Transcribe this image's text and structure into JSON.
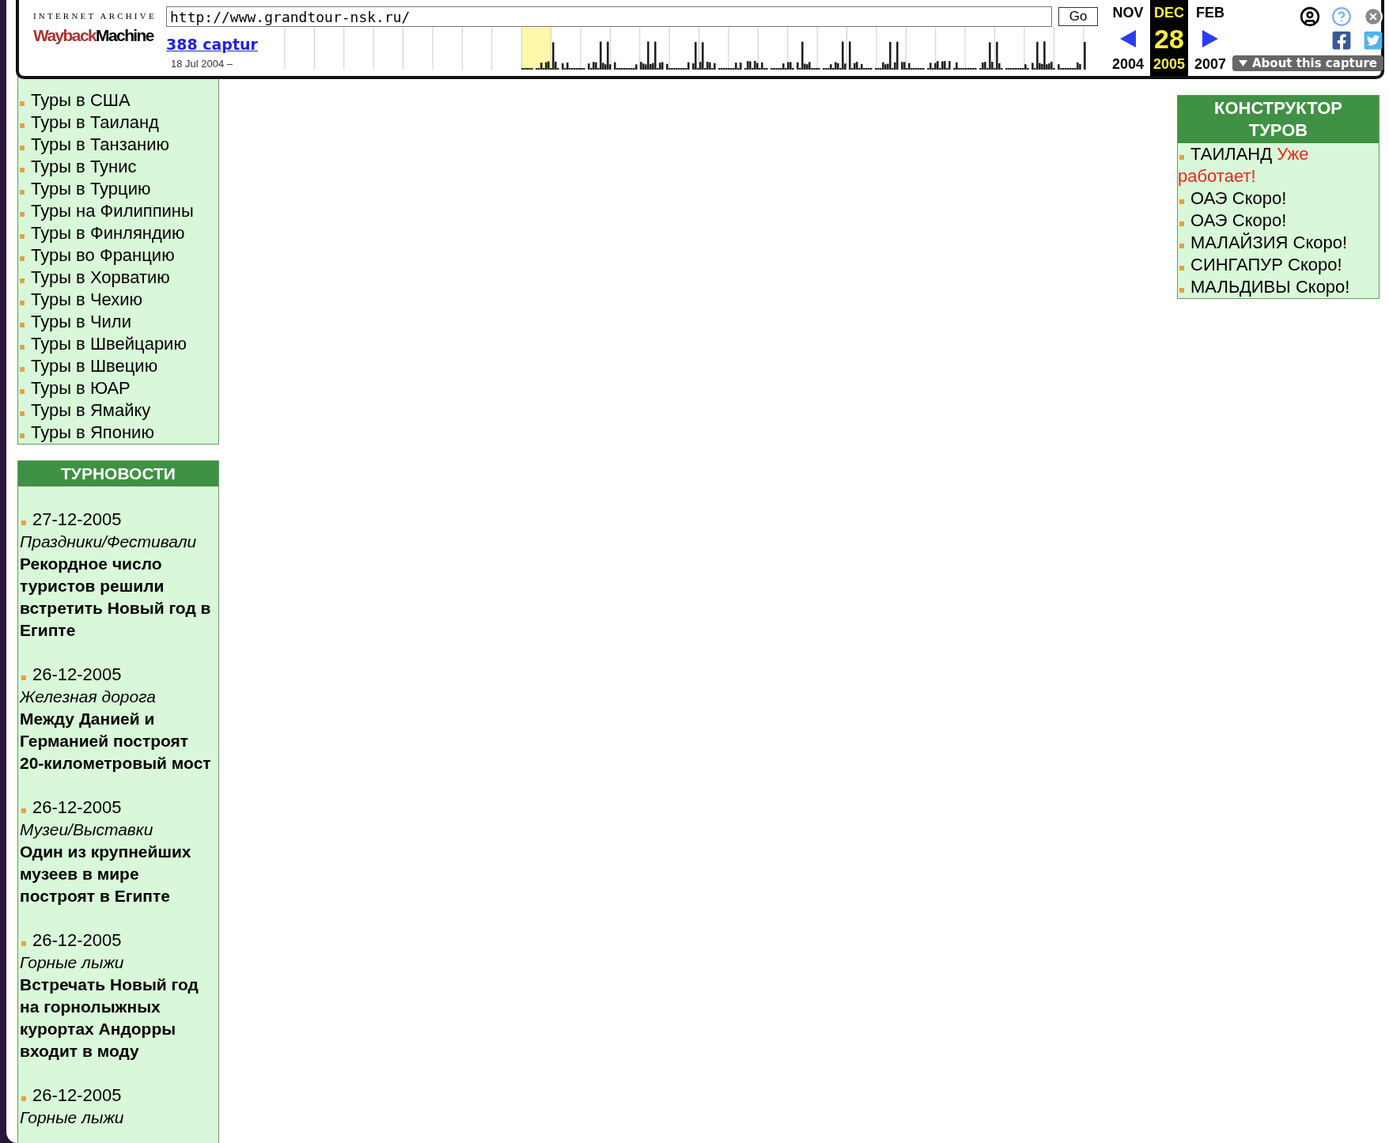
{
  "toolbar": {
    "logo": {
      "caption": "INTERNET ARCHIVE",
      "word_1": "Wayback",
      "word_2": "Machine"
    },
    "url": "http://www.grandtour-nsk.ru/",
    "go_button": "Go",
    "captures_link": "388 captur",
    "date_range": "18 Jul 2004 –",
    "calendar": [
      {
        "month": "NOV",
        "year": "2004",
        "selected": false
      },
      {
        "month": "DEC",
        "day": "28",
        "year": "2005",
        "selected": true
      },
      {
        "month": "FEB",
        "year": "2007",
        "selected": false
      }
    ],
    "about_button": "About this capture"
  },
  "country_list": [
    "Туры в США",
    "Туры в Таиланд",
    "Туры в Танзанию",
    "Туры в Тунис",
    "Туры в Турцию",
    "Туры на Филиппины",
    "Туры в Финляндию",
    "Туры во Францию",
    "Туры в Хорватию",
    "Туры в Чехию",
    "Туры в Чили",
    "Туры в Швейцарию",
    "Туры в Швецию",
    "Туры в ЮАР",
    "Туры в Ямайку",
    "Туры в Японию"
  ],
  "news": {
    "title": "ТУРНОВОСТИ",
    "items": [
      {
        "date": "27-12-2005",
        "category": "Праздники/Фестивали",
        "headline": "Рекордное число туристов решили встретить Новый год в Египте"
      },
      {
        "date": "26-12-2005",
        "category": "Железная дорога",
        "headline": "Между Данией и Германией построят 20-километровый мост"
      },
      {
        "date": "26-12-2005",
        "category": "Музеи/Выставки",
        "headline": "Один из крупнейших музеев в мире построят в Египте"
      },
      {
        "date": "26-12-2005",
        "category": "Горные лыжи",
        "headline": "Встречать Новый год на горнолыжных курортах Андорры входит в моду"
      },
      {
        "date": "26-12-2005",
        "category": "Горные лыжи"
      }
    ]
  },
  "tour_builder": {
    "title": "КОНСТРУКТОР ТУРОВ",
    "items": [
      {
        "destination": "ТАИЛАНД",
        "status": "Уже работает!",
        "available": true
      },
      {
        "destination": "ОАЭ",
        "status": "Скоро!",
        "available": false
      },
      {
        "destination": "ОАЭ",
        "status": "Скоро!",
        "available": false
      },
      {
        "destination": "МАЛАЙЗИЯ",
        "status": "Скоро!",
        "available": false
      },
      {
        "destination": "СИНГАПУР",
        "status": "Скоро!",
        "available": false
      },
      {
        "destination": "МАЛЬДИВЫ",
        "status": "Скоро!",
        "available": false
      }
    ]
  }
}
